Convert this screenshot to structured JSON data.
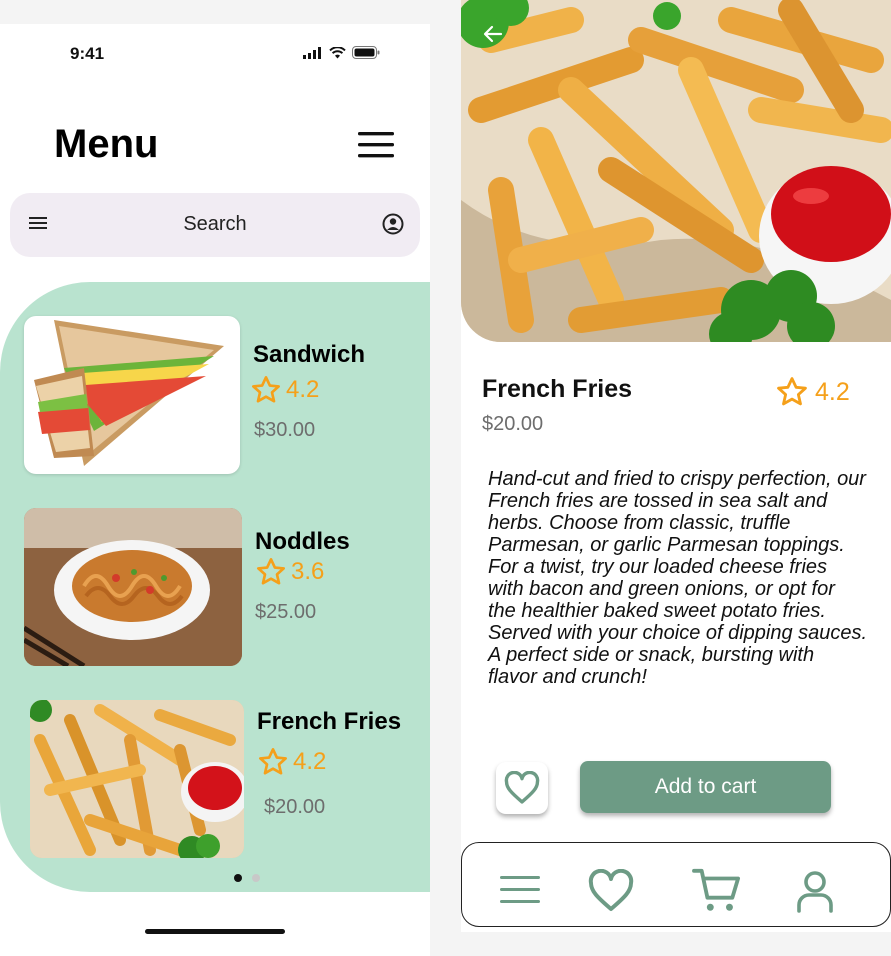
{
  "left": {
    "status_time": "9:41",
    "title": "Menu",
    "search_placeholder": "Search",
    "items": [
      {
        "name": "Sandwich",
        "rating": "4.2",
        "price": "$30.00"
      },
      {
        "name": "Noddles",
        "rating": "3.6",
        "price": "$25.00"
      },
      {
        "name": "French Fries",
        "rating": "4.2",
        "price": "$20.00"
      }
    ]
  },
  "detail": {
    "name": "French Fries",
    "rating": "4.2",
    "price": "$20.00",
    "description": "Hand-cut and fried to crispy perfection, our French fries are tossed in sea salt and herbs. Choose from classic, truffle Parmesan, or garlic Parmesan toppings. For a twist, try our loaded cheese fries with bacon and green onions, or opt for the healthier baked sweet potato fries. Served with your choice of dipping sauces. A perfect side or snack, bursting with flavor and crunch!",
    "add_to_cart_label": "Add to cart"
  },
  "colors": {
    "panel": "#b9e3cf",
    "accent_green": "#6d9b85",
    "star": "#f5a01a",
    "search_bg": "#f1ecf3"
  },
  "icons": {
    "status": [
      "signal-icon",
      "wifi-icon",
      "battery-icon"
    ],
    "bottom_nav": [
      "menu-icon",
      "heart-icon",
      "cart-icon",
      "profile-icon"
    ]
  }
}
